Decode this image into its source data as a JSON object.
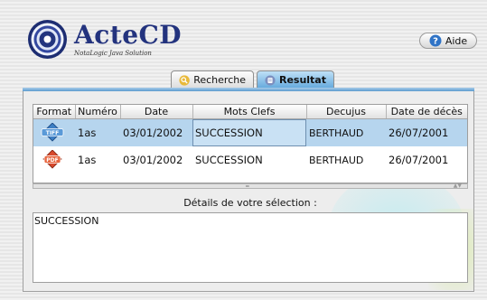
{
  "app": {
    "brand": "ActeCD",
    "tagline": "NotaLogic Java Solution"
  },
  "help": {
    "label": "Aide",
    "icon": "help-icon"
  },
  "tabs": [
    {
      "label": "Recherche",
      "icon": "search-icon",
      "active": false
    },
    {
      "label": "Resultat",
      "icon": "results-icon",
      "active": true
    }
  ],
  "table": {
    "columns": [
      "Format",
      "Numéro",
      "Date",
      "Mots Clefs",
      "Decujus",
      "Date de décès"
    ],
    "rows": [
      {
        "format": "TIFF",
        "numero": "1as",
        "date": "03/01/2002",
        "mots_clefs": "SUCCESSION",
        "decujus": "BERTHAUD",
        "date_deces": "26/07/2001",
        "selected": true
      },
      {
        "format": "PDF",
        "numero": "1as",
        "date": "03/01/2002",
        "mots_clefs": "SUCCESSION",
        "decujus": "BERTHAUD",
        "date_deces": "26/07/2001",
        "selected": false
      }
    ]
  },
  "details": {
    "label": "Détails de votre sélection :",
    "text": "SUCCESSION"
  },
  "colors": {
    "brand": "#23337e",
    "tab_active": "#63a8dc",
    "row_selected": "#b6d5ee",
    "tiff_badge": "#3d7fc4",
    "pdf_badge": "#d9492c"
  }
}
